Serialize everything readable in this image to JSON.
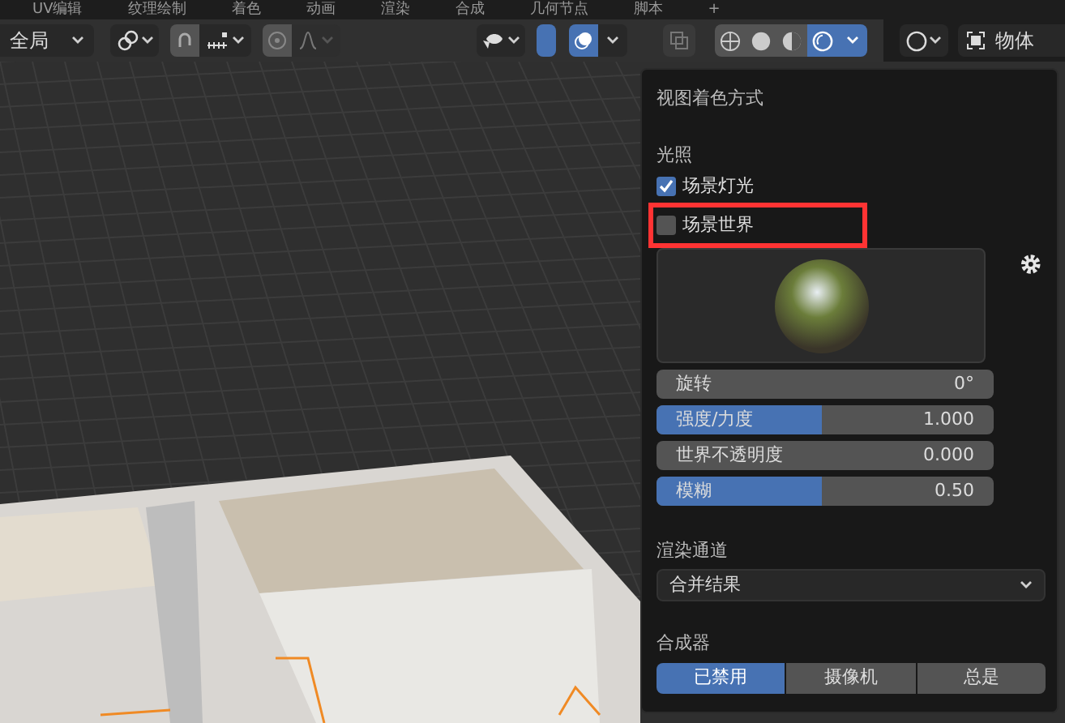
{
  "workspace_tabs": [
    {
      "label": "UV编辑",
      "selected": false
    },
    {
      "label": "纹理绘制",
      "selected": false
    },
    {
      "label": "着色",
      "selected": false
    },
    {
      "label": "动画",
      "selected": false
    },
    {
      "label": "渲染",
      "selected": false
    },
    {
      "label": "合成",
      "selected": false
    },
    {
      "label": "几何节点",
      "selected": false
    },
    {
      "label": "脚本",
      "selected": false
    },
    {
      "label": "+",
      "selected": false
    }
  ],
  "header": {
    "orientation": "全局",
    "snap_on": false,
    "proportional_on": false,
    "overlays_on": true,
    "shading_modes": [
      {
        "selected": false
      },
      {
        "selected": false
      },
      {
        "selected": false
      },
      {
        "selected": true
      }
    ],
    "mode": "物体"
  },
  "popover": {
    "title": "视图着色方式",
    "lighting_label": "光照",
    "checkboxes": [
      {
        "label": "场景灯光",
        "checked": true,
        "highlighted": false
      },
      {
        "label": "场景世界",
        "checked": false,
        "highlighted": true
      }
    ],
    "fields": [
      {
        "kind": "number",
        "label": "旋转",
        "value": "0°"
      },
      {
        "kind": "slider",
        "label": "强度/力度",
        "value": "1.000",
        "level": 0.49
      },
      {
        "kind": "number",
        "label": "世界不透明度",
        "value": "0.000"
      },
      {
        "kind": "slider",
        "label": "模糊",
        "value": "0.50",
        "level": 0.49
      }
    ],
    "render_pass_label": "渲染通道",
    "render_pass": "合并结果",
    "compositor_label": "合成器",
    "compositor_options": [
      {
        "label": "已禁用",
        "selected": true
      },
      {
        "label": "摄像机",
        "selected": false
      },
      {
        "label": "总是",
        "selected": false
      }
    ]
  }
}
